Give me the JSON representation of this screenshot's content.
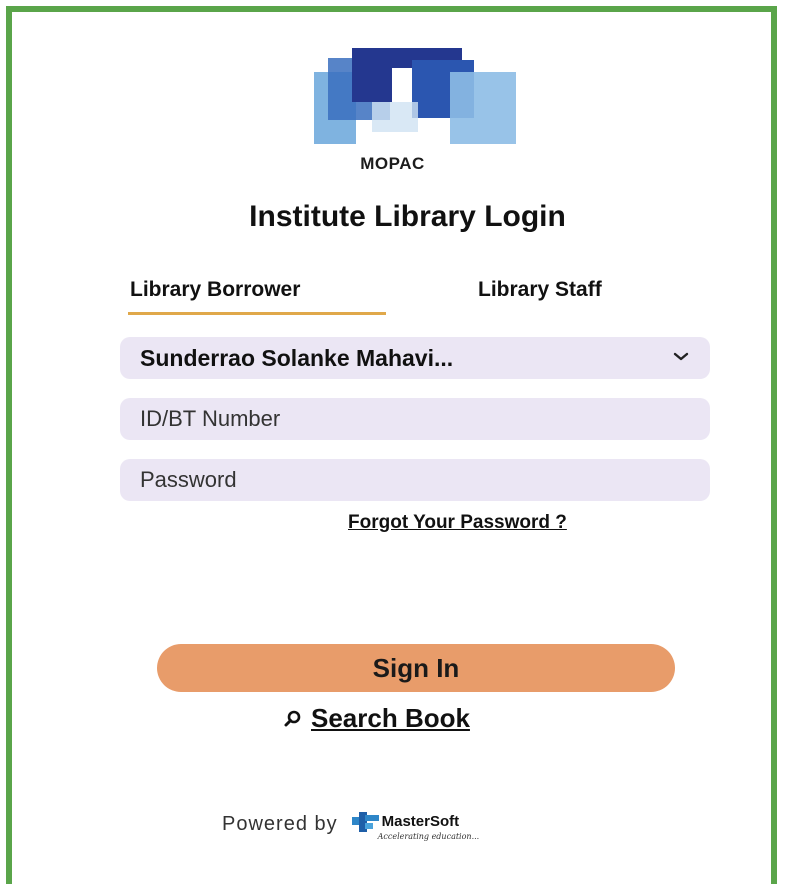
{
  "app": {
    "brand": "MOPAC",
    "title": "Institute Library Login"
  },
  "tabs": [
    {
      "label": "Library Borrower",
      "active": true
    },
    {
      "label": "Library Staff",
      "active": false
    }
  ],
  "form": {
    "institute_value": "Sunderrao Solanke Mahavi...",
    "id_placeholder": "ID/BT Number",
    "password_placeholder": "Password",
    "forgot_label": "Forgot Your Password ?",
    "signin_label": "Sign In",
    "search_label": "Search Book"
  },
  "footer": {
    "powered_label": "Powered by",
    "vendor_name": "MasterSoft",
    "vendor_tagline": "Accelerating education..."
  },
  "colors": {
    "frame": "#5aa54a",
    "tab_underline": "#e0a84a",
    "field_bg": "#ebe6f4",
    "signin_bg": "#e89c6a",
    "logo_dark": "#24378f",
    "logo_light": "#7fb3e0"
  },
  "icons": {
    "dropdown": "chevron-down-icon",
    "search": "search-icon"
  }
}
